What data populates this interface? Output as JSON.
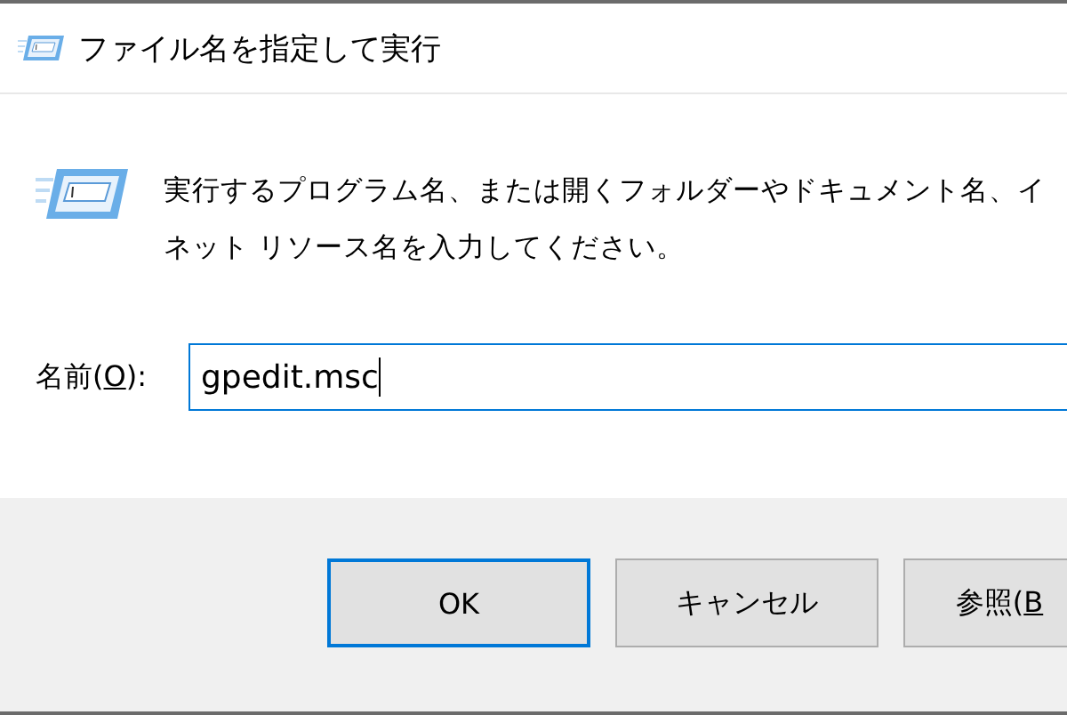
{
  "window": {
    "title": "ファイル名を指定して実行"
  },
  "description": [
    "実行するプログラム名、または開くフォルダーやドキュメント名、イ",
    "ネット リソース名を入力してください。"
  ],
  "name_field": {
    "label_parts": [
      "名前(",
      "O",
      "):"
    ],
    "value": "gpedit.msc",
    "focused": true
  },
  "buttons": [
    {
      "label_parts": [
        "OK"
      ],
      "default": true
    },
    {
      "label_parts": [
        "キャンセル"
      ],
      "default": false
    },
    {
      "label_parts": [
        "参照(",
        "B"
      ],
      "default": false
    }
  ]
}
